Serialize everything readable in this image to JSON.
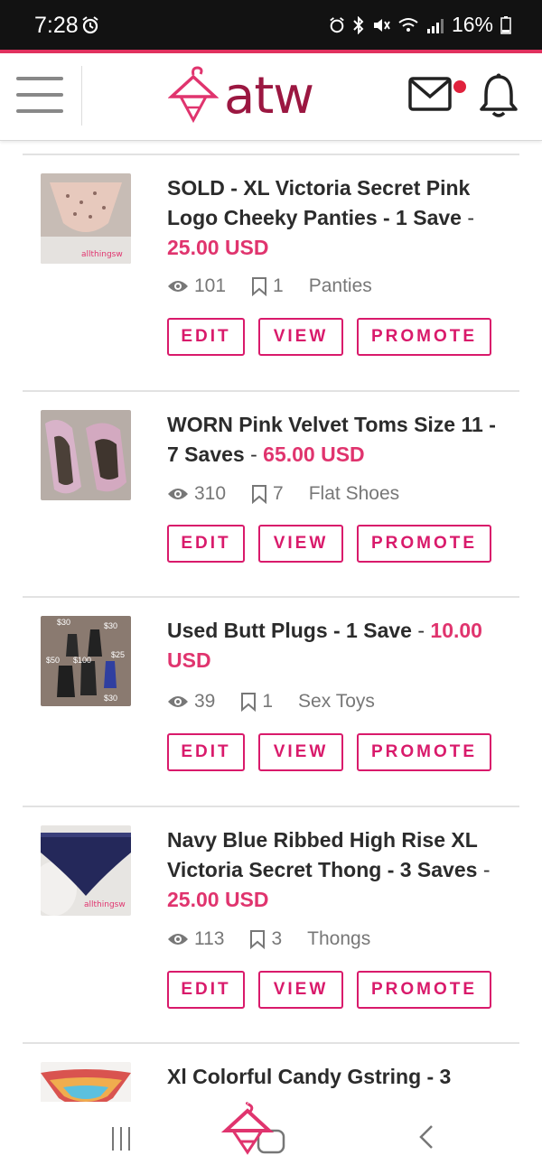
{
  "status_bar": {
    "time": "7:28",
    "battery": "16%"
  },
  "header": {
    "logo_text": "atw"
  },
  "listings": [
    {
      "title": "SOLD - XL Victoria Secret Pink Logo Cheeky Panties - 1 Save",
      "separator": " - ",
      "price": "25.00 USD",
      "views": "101",
      "saves": "1",
      "category": "Panties",
      "watermark": "allthingsw"
    },
    {
      "title": "WORN Pink Velvet Toms Size 11 - 7 Saves",
      "separator": " - ",
      "price": "65.00 USD",
      "views": "310",
      "saves": "7",
      "category": "Flat Shoes"
    },
    {
      "title": "Used Butt Plugs - 1 Save",
      "separator": " - ",
      "price": "10.00 USD",
      "views": "39",
      "saves": "1",
      "category": "Sex Toys",
      "photo_labels": [
        "$30",
        "$30",
        "$50",
        "$100",
        "$25",
        "$30"
      ]
    },
    {
      "title": "Navy Blue Ribbed High Rise XL Victoria Secret Thong - 3 Saves",
      "separator": " - ",
      "price": "25.00 USD",
      "views": "113",
      "saves": "3",
      "category": "Thongs",
      "watermark": "allthingsw"
    },
    {
      "title": "Xl Colorful Candy Gstring - 3",
      "separator": "",
      "price": ""
    }
  ],
  "buttons": {
    "edit": "EDIT",
    "view": "VIEW",
    "promote": "PROMOTE"
  },
  "colors": {
    "accent": "#d91a6b",
    "price": "#e0346e",
    "logo": "#9b1741"
  }
}
